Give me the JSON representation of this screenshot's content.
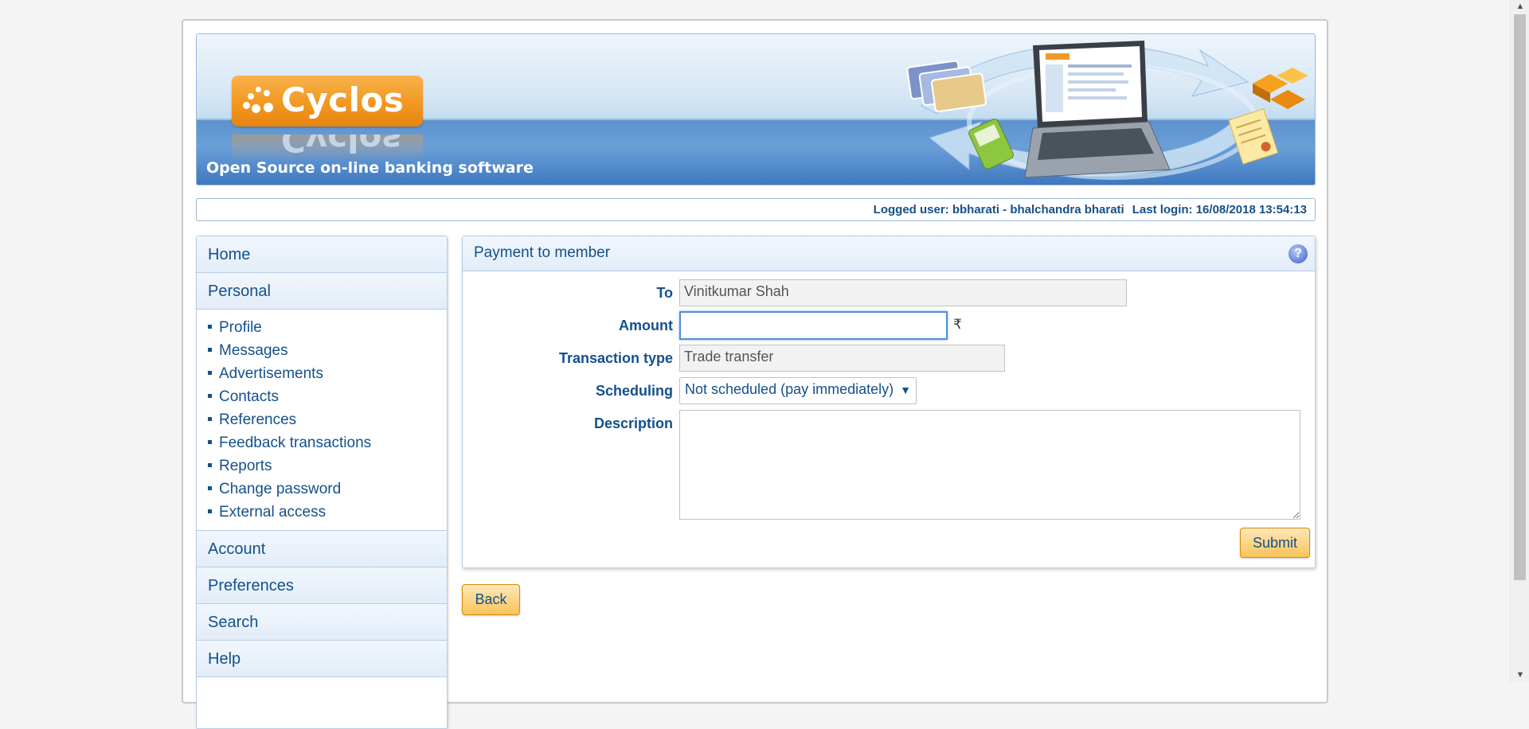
{
  "header": {
    "logo_text": "Cyclos",
    "tagline": "Open Source on-line banking software"
  },
  "status": {
    "logged_user": "Logged user: bbharati - bhalchandra bharati",
    "last_login": "Last login: 16/08/2018 13:54:13"
  },
  "sidebar": {
    "home": "Home",
    "personal": "Personal",
    "personal_items": [
      "Profile",
      "Messages",
      "Advertisements",
      "Contacts",
      "References",
      "Feedback transactions",
      "Reports",
      "Change password",
      "External access"
    ],
    "account": "Account",
    "preferences": "Preferences",
    "search": "Search",
    "help": "Help"
  },
  "form": {
    "title": "Payment to member",
    "help_icon": "?",
    "to_label": "To",
    "to_value": "Vinitkumar Shah",
    "amount_label": "Amount",
    "amount_value": "",
    "currency_symbol": "₹",
    "transaction_type_label": "Transaction type",
    "transaction_type_value": "Trade transfer",
    "scheduling_label": "Scheduling",
    "scheduling_value": "Not scheduled (pay immediately)",
    "description_label": "Description",
    "description_value": "",
    "submit_label": "Submit"
  },
  "back_label": "Back",
  "icons": {
    "help": "help-icon",
    "dropdown": "chevron-down-icon",
    "scroll_up": "scroll-up-arrow-icon",
    "scroll_down": "scroll-down-arrow-icon"
  },
  "colors": {
    "text_primary": "#14508c",
    "button_fill": "#fbd27e",
    "button_border": "#d88b0c",
    "logo_orange": "#f29a25",
    "banner_blue": "#5d92cf"
  }
}
